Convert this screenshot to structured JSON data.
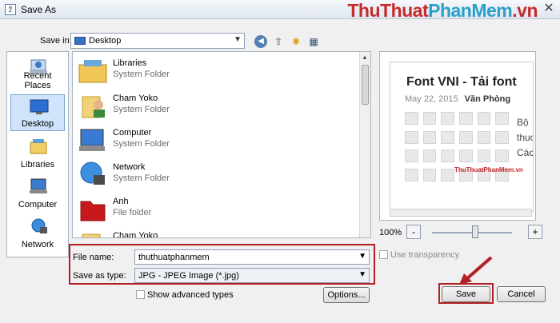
{
  "window": {
    "title": "Save As",
    "watermark_part1": "ThuThuat",
    "watermark_part2": "PhanMem",
    "watermark_part3": ".vn"
  },
  "save_in": {
    "label": "Save in:",
    "value": "Desktop"
  },
  "places": [
    {
      "label": "Recent Places"
    },
    {
      "label": "Desktop"
    },
    {
      "label": "Libraries"
    },
    {
      "label": "Computer"
    },
    {
      "label": "Network"
    }
  ],
  "files": [
    {
      "name": "Libraries",
      "type": "System Folder"
    },
    {
      "name": "Cham Yoko",
      "type": "System Folder"
    },
    {
      "name": "Computer",
      "type": "System Folder"
    },
    {
      "name": "Network",
      "type": "System Folder"
    },
    {
      "name": "Anh",
      "type": "File folder"
    },
    {
      "name": "Cham Yoko",
      "type": ""
    }
  ],
  "preview": {
    "title": "Font VNI - Tải font",
    "date": "May 22, 2015",
    "author": "Văn Phòng",
    "side_lines": [
      "Bộ",
      "thuơ",
      "Các"
    ],
    "watermark": "ThuThuatPhanMem.vn"
  },
  "zoom": {
    "percent": "100%",
    "minus": "-",
    "plus": "+"
  },
  "use_transparency": "Use transparency",
  "file_name": {
    "label": "File name:",
    "value": "thuthuatphanmem"
  },
  "save_as_type": {
    "label": "Save as type:",
    "value": "JPG - JPEG Image (*.jpg)"
  },
  "show_advanced": "Show advanced types",
  "buttons": {
    "options": "Options...",
    "save": "Save",
    "cancel": "Cancel"
  },
  "colors": {
    "highlight": "#b21f24",
    "selection": "#cfe4fb"
  }
}
